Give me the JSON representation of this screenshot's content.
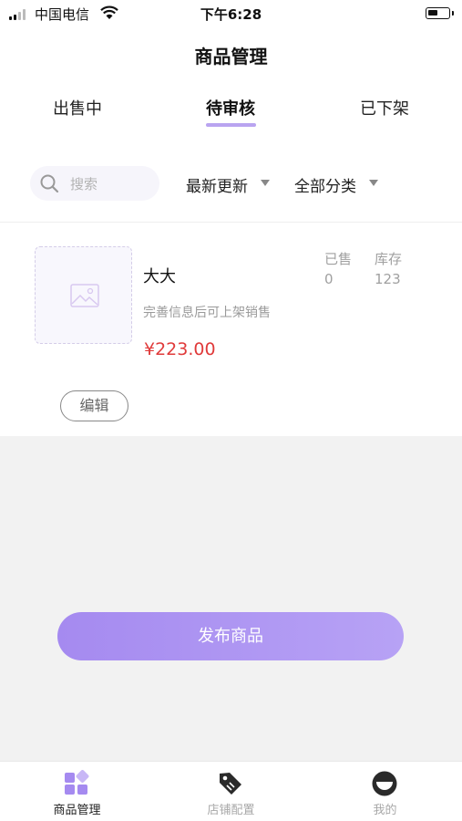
{
  "status_bar": {
    "carrier": "中国电信",
    "time": "下午6:28"
  },
  "header": {
    "title": "商品管理"
  },
  "tabs": [
    {
      "label": "出售中",
      "active": false
    },
    {
      "label": "待审核",
      "active": true
    },
    {
      "label": "已下架",
      "active": false
    }
  ],
  "filters": {
    "search_placeholder": "搜索",
    "sort_label": "最新更新",
    "category_label": "全部分类"
  },
  "product": {
    "name": "大大",
    "description": "完善信息后可上架销售",
    "price": "¥223.00",
    "sold_label": "已售",
    "sold_value": "0",
    "stock_label": "库存",
    "stock_value": "123",
    "edit_label": "编辑"
  },
  "publish_button_label": "发布商品",
  "bottom_nav": [
    {
      "label": "商品管理",
      "icon": "grid-icon",
      "active": true
    },
    {
      "label": "店铺配置",
      "icon": "tag-icon",
      "active": false
    },
    {
      "label": "我的",
      "icon": "profile-icon",
      "active": false
    }
  ],
  "colors": {
    "accent": "#a58af0",
    "price": "#e03a3a",
    "background": "#f2f2f2"
  }
}
